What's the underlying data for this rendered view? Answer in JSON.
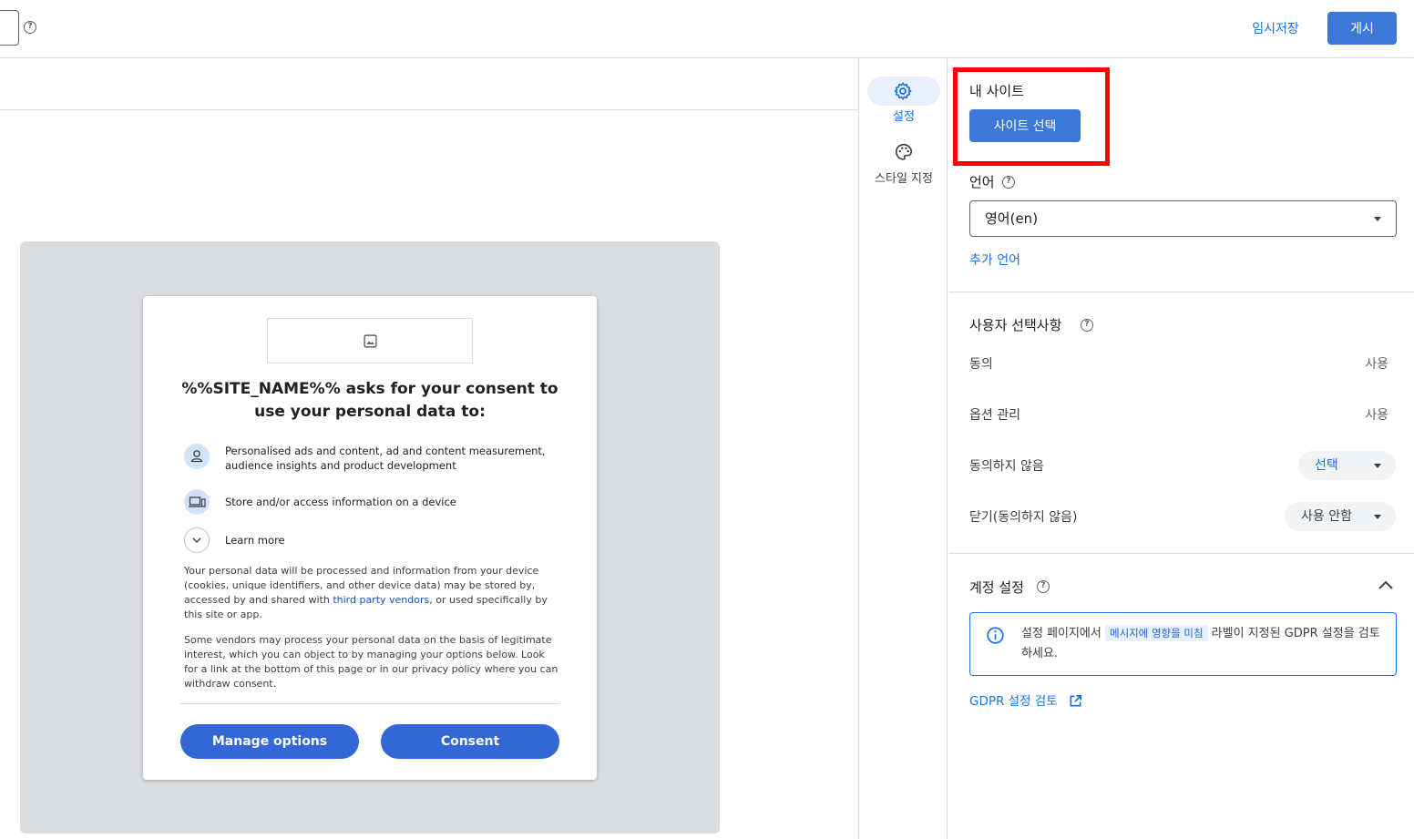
{
  "header": {
    "draft_label": "임시저장",
    "publish_label": "게시"
  },
  "preview": {
    "title": "%%SITE_NAME%% asks for your consent to use your personal data to:",
    "purposes": [
      {
        "icon": "person-icon",
        "text": "Personalised ads and content, ad and content measurement, audience insights and product development"
      },
      {
        "icon": "devices-icon",
        "text": "Store and/or access information on a device"
      }
    ],
    "learn_more": "Learn more",
    "paragraph1_before": "Your personal data will be processed and information from your device (cookies, unique identifiers, and other device data) may be stored by, accessed by and shared with ",
    "paragraph1_link": "third party vendors",
    "paragraph1_after": ", or used specifically by this site or app.",
    "paragraph2": "Some vendors may process your personal data on the basis of legitimate interest, which you can object to by managing your options below. Look for a link at the bottom of this page or in our privacy policy where you can withdraw consent.",
    "manage_options": "Manage options",
    "consent": "Consent"
  },
  "rail": {
    "settings_label": "설정",
    "style_label": "스타일 지정"
  },
  "panel": {
    "my_site_title": "내 사이트",
    "site_select_button": "사이트 선택",
    "language_title": "언어",
    "language_value": "영어(en)",
    "add_language": "추가 언어",
    "user_choices_title": "사용자 선택사항",
    "choices": [
      {
        "label": "동의",
        "value": "사용"
      },
      {
        "label": "옵션 관리",
        "value": "사용"
      },
      {
        "label": "동의하지 않음",
        "value": "선택"
      },
      {
        "label": "닫기(동의하지 않음)",
        "value": "사용 안함"
      }
    ],
    "account_settings_title": "계정 설정",
    "info_before": "설정 페이지에서 ",
    "info_tag": "메시지에 영향을 미침",
    "info_after": " 라벨이 지정된 GDPR 설정을 검토하세요.",
    "gdpr_link": "GDPR 설정 검토"
  },
  "colors": {
    "primary_button": "#3c78d8",
    "link": "#1a73e8",
    "highlight": "#ff0000"
  }
}
